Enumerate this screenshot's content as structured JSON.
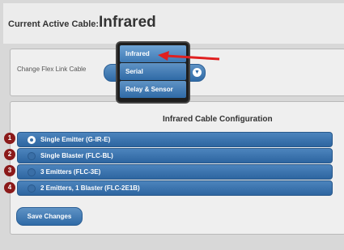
{
  "header": {
    "caption": "Current Active Cable:",
    "active_cable": "Infrared"
  },
  "flex_link": {
    "label": "Change Flex Link Cable",
    "options": [
      "Infrared",
      "Serial",
      "Relay & Sensor"
    ],
    "selected": "Infrared"
  },
  "config": {
    "title": "Infrared Cable Configuration",
    "options": [
      {
        "badge": "1",
        "label": "Single Emitter (G-IR-E)",
        "checked": true
      },
      {
        "badge": "2",
        "label": "Single Blaster (FLC-BL)",
        "checked": false
      },
      {
        "badge": "3",
        "label": "3 Emitters (FLC-3E)",
        "checked": false
      },
      {
        "badge": "4",
        "label": "2 Emitters, 1 Blaster (FLC-2E1B)",
        "checked": false
      }
    ],
    "save_label": "Save Changes"
  },
  "colors": {
    "accent": "#2f6aa6",
    "badge": "#8b1a1a",
    "arrow": "#e02020"
  }
}
